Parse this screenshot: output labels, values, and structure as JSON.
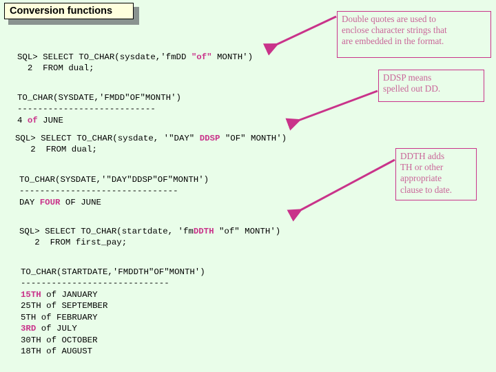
{
  "slide": {
    "background_color": "#e9fde9",
    "title": "Conversion functions",
    "accent_color": "#c9338a",
    "title_bg_color": "#ffffdd",
    "callout_text_color": "#c96699"
  },
  "code_blocks": {
    "block1": {
      "line1_a": "SQL> SELECT TO_CHAR(sysdate,'fmDD ",
      "line1_hl": "\"of\"",
      "line1_b": " MONTH')",
      "line2": "  2  FROM dual;"
    },
    "block2": {
      "header": "TO_CHAR(SYSDATE,'FMDD\"OF\"MONTH')",
      "rule": "---------------------------",
      "row_a": "4 ",
      "row_hl": "of",
      "row_b": " JUNE"
    },
    "block3": {
      "line1_a": "SQL> SELECT TO_CHAR(sysdate, '\"DAY\" ",
      "line1_hl": "DDSP",
      "line1_b": " \"OF\" MONTH')",
      "line2": "   2  FROM dual;"
    },
    "block4": {
      "header": "TO_CHAR(SYSDATE,'\"DAY\"DDSP\"OF\"MONTH')",
      "rule": "-------------------------------",
      "row_a": "DAY ",
      "row_hl": "FOUR",
      "row_b": " OF JUNE"
    },
    "block5": {
      "line1_a": "SQL> SELECT TO_CHAR(startdate, 'fm",
      "line1_hl": "DDTH",
      "line1_b": " \"of\" MONTH')",
      "line2": "   2  FROM first_pay;"
    },
    "block6": {
      "header": "TO_CHAR(STARTDATE,'FMDDTH\"OF\"MONTH')",
      "rule": "-----------------------------",
      "rows": [
        {
          "ord": "15TH",
          "highlight": true,
          "rest": " of JANUARY"
        },
        {
          "ord": "25TH",
          "highlight": false,
          "rest": " of SEPTEMBER"
        },
        {
          "ord": "5TH",
          "highlight": false,
          "rest": " of FEBRUARY"
        },
        {
          "ord": "3RD",
          "highlight": true,
          "rest": " of JULY"
        },
        {
          "ord": "30TH",
          "highlight": false,
          "rest": " of OCTOBER"
        },
        {
          "ord": "18TH",
          "highlight": false,
          "rest": " of AUGUST"
        }
      ]
    }
  },
  "callouts": {
    "double_quotes": {
      "line1": "Double quotes are used to",
      "line2": "enclose character strings that",
      "line3": "are embedded in the format."
    },
    "ddsp": {
      "line1": "DDSP means",
      "line2": "spelled out DD."
    },
    "ddth": {
      "line1": "DDTH adds",
      "line2": "TH or other",
      "line3": "appropriate",
      "line4": "clause to date."
    }
  }
}
